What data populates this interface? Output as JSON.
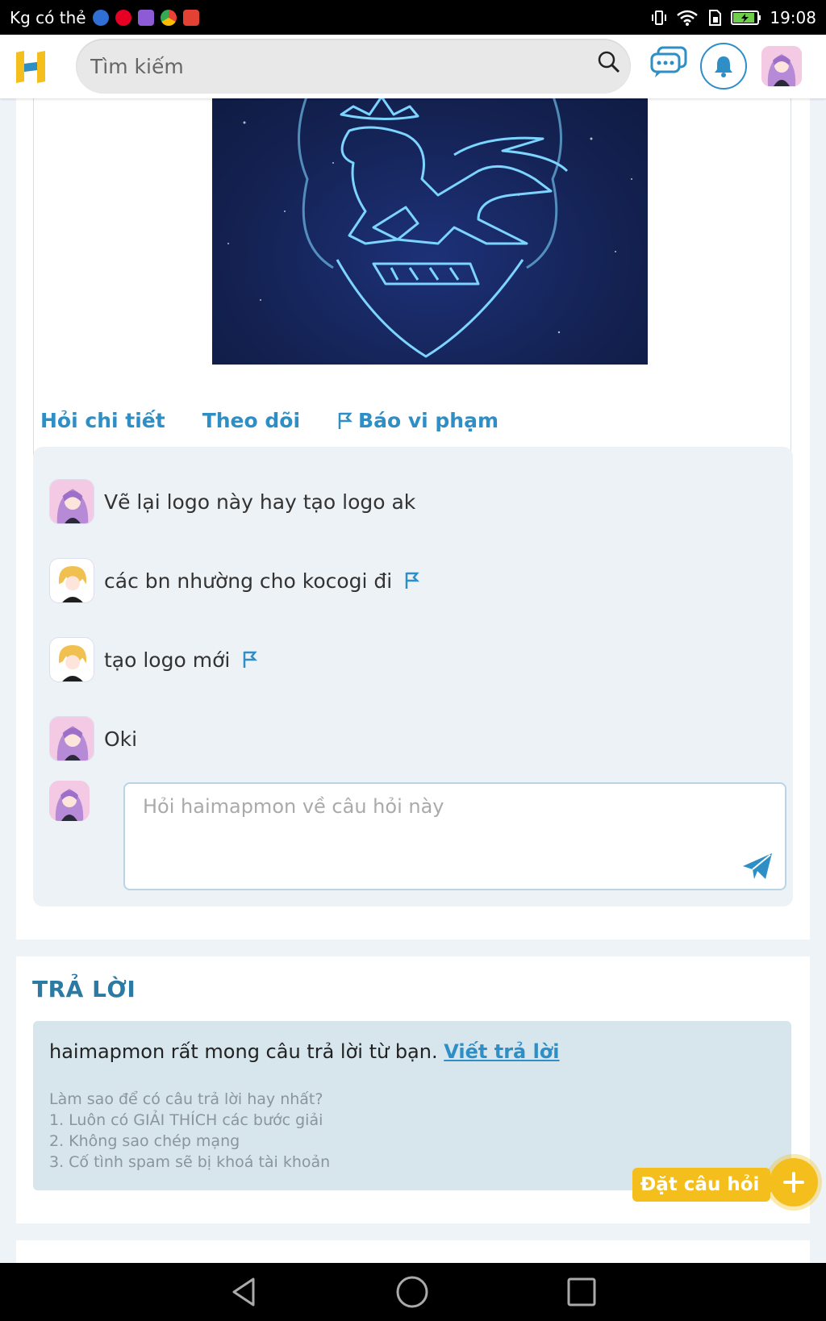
{
  "status_bar": {
    "carrier": "Kg có thẻ",
    "time": "19:08",
    "apps": [
      "messenger-icon",
      "pinterest-icon",
      "gallery-icon",
      "chrome-icon",
      "gmail-icon"
    ]
  },
  "header": {
    "search_placeholder": "Tìm kiếm"
  },
  "question": {
    "actions": {
      "ask_detail": "Hỏi chi tiết",
      "follow": "Theo dõi",
      "report": "Báo vi phạm"
    },
    "comments": [
      {
        "text": "Vẽ lại logo này hay tạo logo ak",
        "author_avatar": "purple-hair",
        "flag": false
      },
      {
        "text": "các bn nhường cho kocogi đi",
        "author_avatar": "blonde-hair",
        "flag": true
      },
      {
        "text": "tạo logo mới",
        "author_avatar": "blonde-hair",
        "flag": true
      },
      {
        "text": "Oki",
        "author_avatar": "purple-hair",
        "flag": false
      }
    ],
    "ask_placeholder": "Hỏi haimapmon về câu hỏi này"
  },
  "answer": {
    "title": "TRẢ LỜI",
    "message": "haimapmon rất mong câu trả lời từ bạn.",
    "write_link": "Viết trả lời",
    "tips_title": "Làm sao để có câu trả lời hay nhất?",
    "tips": [
      "1. Luôn có GIẢI THÍCH các bước giải",
      "2. Không sao chép mạng",
      "3. Cố tình spam sẽ bị khoá tài khoản"
    ]
  },
  "fab": {
    "label": "Đặt câu hỏi"
  },
  "colors": {
    "accent": "#2e8ec6",
    "fab": "#f4bf1d",
    "logo": "#f4bf1d"
  }
}
